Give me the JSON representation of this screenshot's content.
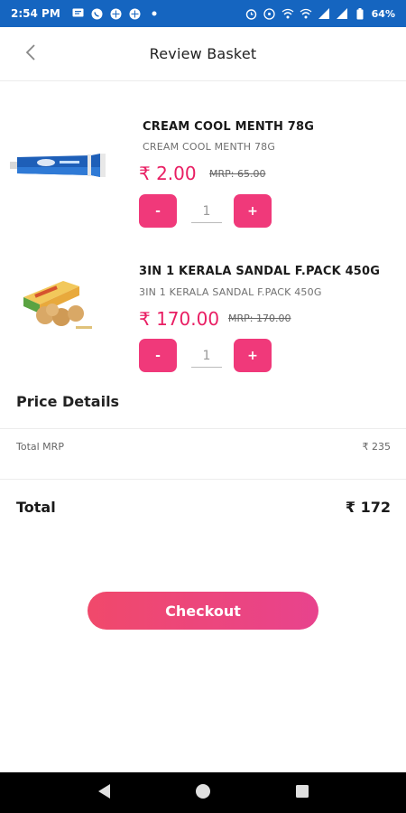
{
  "status_bar": {
    "time": "2:54 PM",
    "battery": "64%",
    "icons_left": [
      "message-icon",
      "whatsapp-icon",
      "grid-icon",
      "grid-icon",
      "dot-icon"
    ],
    "icons_right": [
      "alarm-icon",
      "hotspot-icon",
      "vowifi-icon",
      "vowifi-icon",
      "signal-icon",
      "signal-icon",
      "battery-icon"
    ]
  },
  "header": {
    "title": "Review Basket",
    "back_icon": "chevron-left-icon"
  },
  "products": [
    {
      "title": "CREAM COOL MENTH 78G",
      "subtitle": "CREAM COOL MENTH 78G",
      "price": "₹ 2.00",
      "mrp": "MRP: 65.00",
      "minus_label": "-",
      "quantity": "1",
      "plus_label": "+",
      "image_icon": "toothpaste-tube-image"
    },
    {
      "title": "3IN 1 KERALA SANDAL F.PACK 450G",
      "subtitle": "3IN 1 KERALA SANDAL F.PACK 450G",
      "price": "₹ 170.00",
      "mrp": "MRP: 170.00",
      "minus_label": "-",
      "quantity": "1",
      "plus_label": "+",
      "image_icon": "sandal-pack-image"
    }
  ],
  "price_details": {
    "title": "Price Details",
    "total_mrp_label": "Total MRP",
    "total_mrp_value": "₹ 235",
    "total_label": "Total",
    "total_value": "₹ 172"
  },
  "checkout": {
    "label": "Checkout"
  },
  "colors": {
    "accent": "#f0397a",
    "price": "#e91e63",
    "status_bar": "#1565c0",
    "checkout_start": "#f0496b",
    "checkout_end": "#e8438d"
  },
  "nav_bar": {
    "icons": [
      "back-triangle-icon",
      "home-circle-icon",
      "recents-square-icon"
    ]
  }
}
